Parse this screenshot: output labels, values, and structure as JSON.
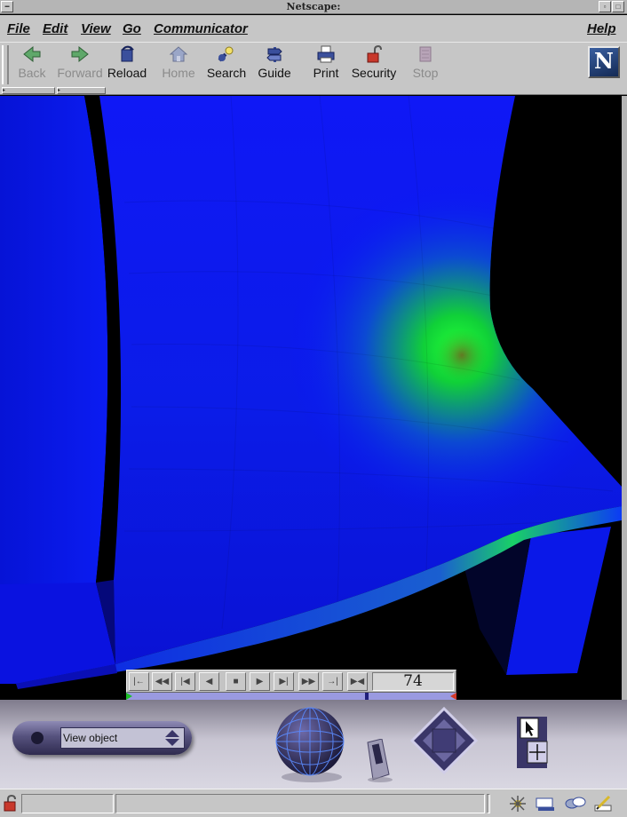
{
  "window": {
    "title": "Netscape:"
  },
  "menu": {
    "file": "File",
    "edit": "Edit",
    "view": "View",
    "go": "Go",
    "communicator": "Communicator",
    "help": "Help"
  },
  "toolbar": {
    "back": "Back",
    "forward": "Forward",
    "reload": "Reload",
    "home": "Home",
    "search": "Search",
    "guide": "Guide",
    "print": "Print",
    "security": "Security",
    "stop": "Stop"
  },
  "logo": {
    "letter": "N"
  },
  "player": {
    "frame": "74",
    "progress": 0.73
  },
  "viewpoint": {
    "label": "View object"
  },
  "colors": {
    "chrome": "#c6c6c6",
    "surface": "#0000ff",
    "highlight": "#00ff00",
    "cosmo_dark": "#3a3668"
  }
}
